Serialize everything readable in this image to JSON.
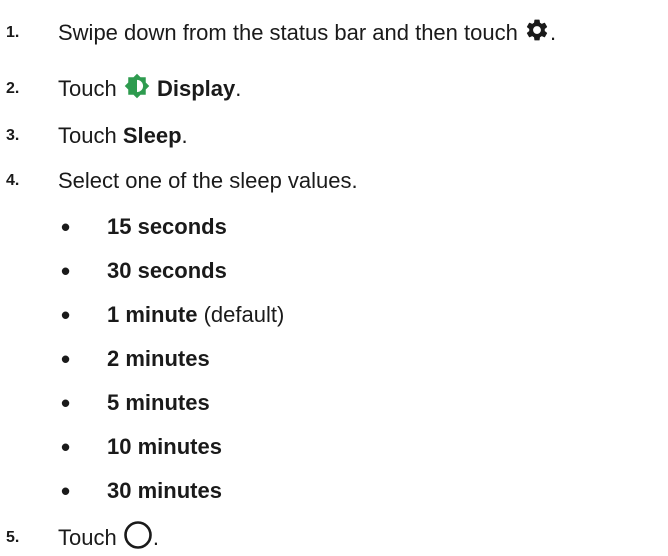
{
  "steps": [
    {
      "number": "1.",
      "text": "Swipe down from the status bar and then touch",
      "icon": "gear-icon",
      "suffix": "."
    },
    {
      "number": "2.",
      "text": "Touch",
      "icon": "display-brightness-icon",
      "bold": "Display",
      "suffix": "."
    },
    {
      "number": "3.",
      "text": "Touch",
      "bold": "Sleep",
      "suffix": "."
    },
    {
      "number": "4.",
      "text": "Select one of the sleep values."
    },
    {
      "number": "5.",
      "text": "Touch",
      "icon": "home-circle-icon",
      "suffix": "."
    }
  ],
  "sleep_values": [
    {
      "bullet": "•",
      "bold": "15 seconds",
      "note": ""
    },
    {
      "bullet": "•",
      "bold": "30 seconds",
      "note": ""
    },
    {
      "bullet": "•",
      "bold": "1 minute",
      "note": " (default)"
    },
    {
      "bullet": "•",
      "bold": "2 minutes",
      "note": ""
    },
    {
      "bullet": "•",
      "bold": "5 minutes",
      "note": ""
    },
    {
      "bullet": "•",
      "bold": "10 minutes",
      "note": ""
    },
    {
      "bullet": "•",
      "bold": "30 minutes",
      "note": ""
    }
  ],
  "colors": {
    "display_icon": "#2e9b4f",
    "text": "#1a1a1a"
  }
}
